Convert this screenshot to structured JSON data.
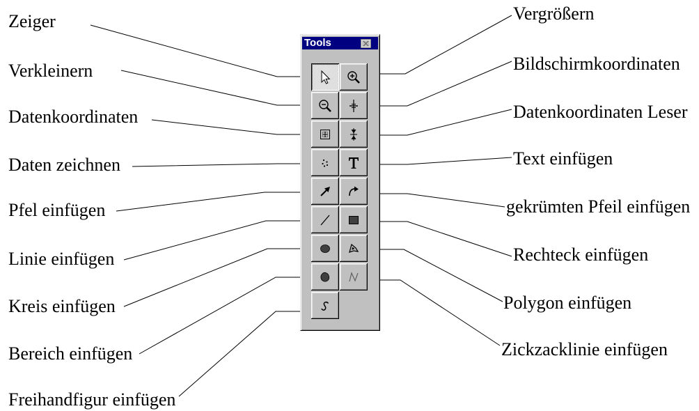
{
  "palette": {
    "title": "Tools",
    "close_icon": "close-icon",
    "buttons": [
      {
        "icon": "pointer-icon",
        "pressed": true
      },
      {
        "icon": "zoom-in-icon",
        "pressed": false
      },
      {
        "icon": "zoom-out-icon",
        "pressed": false
      },
      {
        "icon": "screen-coordinates-icon",
        "pressed": false
      },
      {
        "icon": "data-coordinates-icon",
        "pressed": false
      },
      {
        "icon": "data-reader-icon",
        "pressed": false
      },
      {
        "icon": "draw-data-icon",
        "pressed": false
      },
      {
        "icon": "text-icon",
        "pressed": false
      },
      {
        "icon": "arrow-icon",
        "pressed": false
      },
      {
        "icon": "curved-arrow-icon",
        "pressed": false
      },
      {
        "icon": "line-icon",
        "pressed": false
      },
      {
        "icon": "rectangle-icon",
        "pressed": false
      },
      {
        "icon": "ellipse-icon",
        "pressed": false
      },
      {
        "icon": "polygon-icon",
        "pressed": false
      },
      {
        "icon": "region-icon",
        "pressed": false
      },
      {
        "icon": "zigzag-icon",
        "pressed": false
      },
      {
        "icon": "freehand-icon",
        "pressed": false
      }
    ]
  },
  "callouts": {
    "left": [
      "Zeiger",
      "Verkleinern",
      "Datenkoordinaten",
      "Daten zeichnen",
      "Pfel einfügen",
      "Linie einfügen",
      "Kreis einfügen",
      "Bereich einfügen",
      "Freihandfigur einfügen"
    ],
    "right": [
      "Vergrößern",
      "Bildschirmkoordinaten",
      "Datenkoordinaten Leser",
      "Text einfügen",
      "gekrümten Pfeil einfügen",
      "Rechteck einfügen",
      "Polygon einfügen",
      "Zickzacklinie einfügen"
    ]
  },
  "colors": {
    "title_bar": "#000080",
    "title_text": "#ffffff",
    "button_face": "#c0c0c0",
    "page_background": "#ffffff"
  }
}
